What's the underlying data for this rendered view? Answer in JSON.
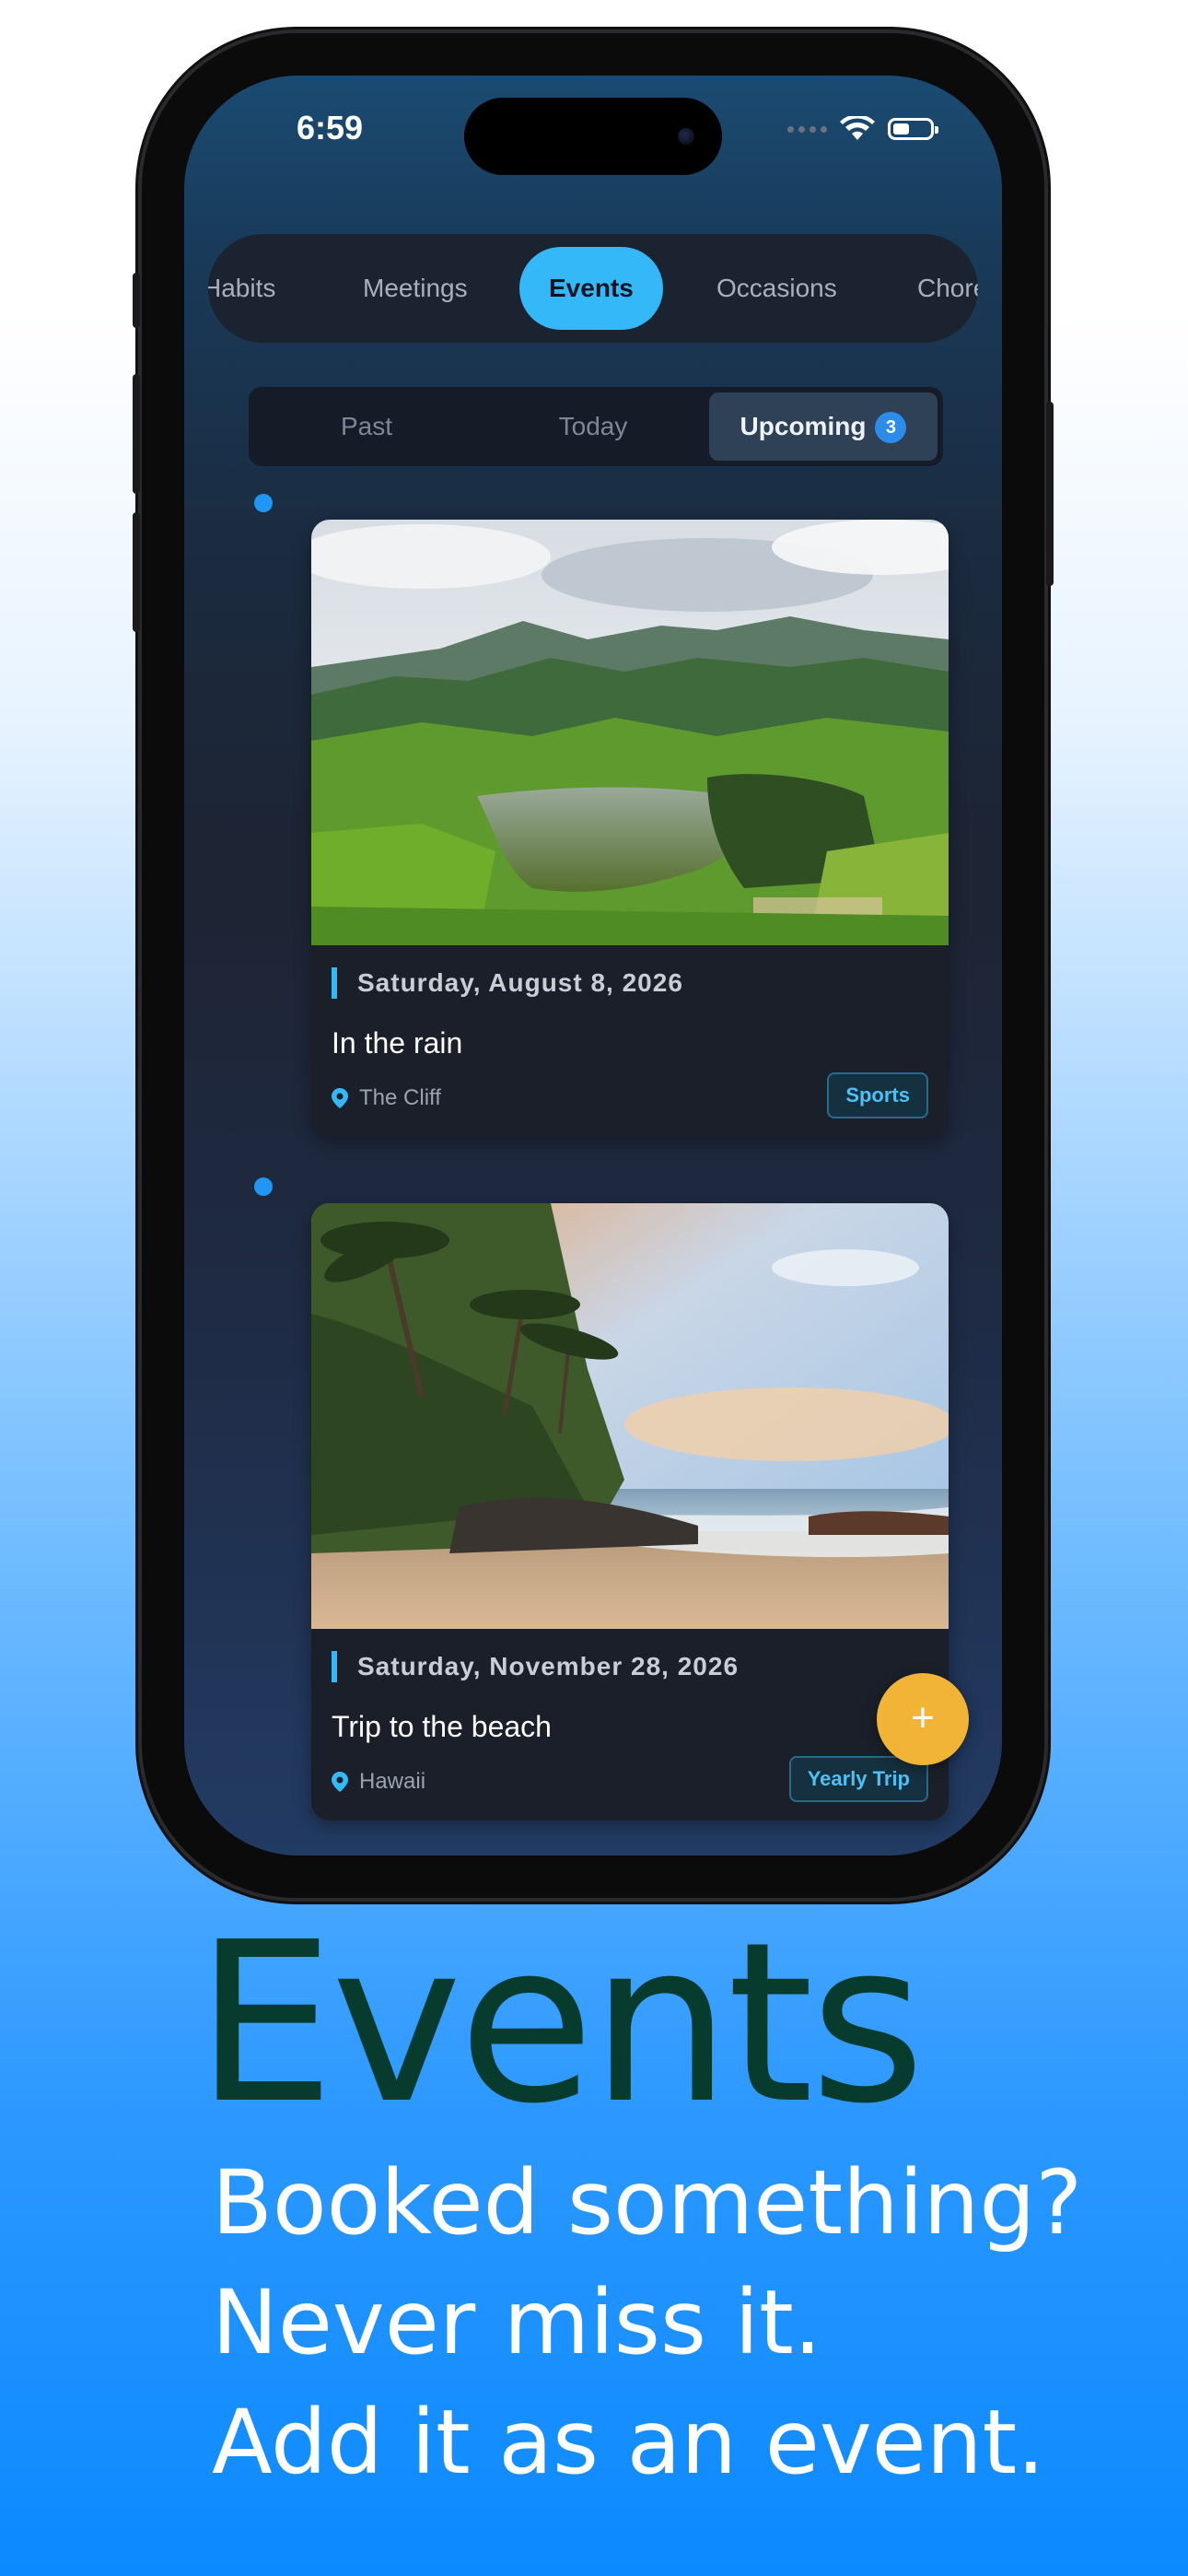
{
  "status_bar": {
    "time": "6:59"
  },
  "categories": [
    "Habits",
    "Meetings",
    "Events",
    "Occasions",
    "Chores"
  ],
  "active_category": "Events",
  "tabs": {
    "past": "Past",
    "today": "Today",
    "upcoming": "Upcoming",
    "upcoming_count": "3",
    "active": "Upcoming"
  },
  "events": [
    {
      "date": "Saturday, August 8, 2026",
      "title": "In the rain",
      "location": "The Cliff",
      "tag": "Sports",
      "image": "mountain lake landscape"
    },
    {
      "date": "Saturday, November 28, 2026",
      "title": "Trip to the beach",
      "location": "Hawaii",
      "tag": "Yearly Trip",
      "image": "tropical beach with palm trees"
    }
  ],
  "fab": {
    "icon": "plus-icon",
    "label": "+"
  },
  "marketing": {
    "headline": "Events",
    "lines": [
      "Booked something?",
      "Never miss it.",
      "Add it as an event."
    ]
  },
  "colors": {
    "accent": "#35b8f7",
    "fab": "#f2b437",
    "headline": "#063b2e"
  }
}
